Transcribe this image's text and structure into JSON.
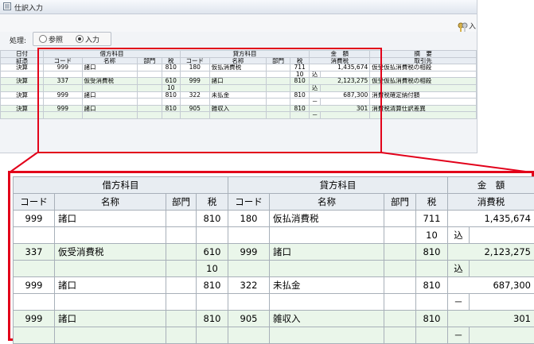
{
  "window": {
    "title": "仕訳入力",
    "toolbar_label": "入"
  },
  "mode": {
    "label": "処理:",
    "options": [
      "参照",
      "入力"
    ],
    "selected": 1
  },
  "small_table": {
    "header_row1": [
      "日付",
      "借方科目",
      "貸方科目",
      "金　額",
      "摘　要"
    ],
    "header_row2": [
      "証憑",
      "コード",
      "名称",
      "部門",
      "税",
      "コード",
      "名称",
      "部門",
      "税",
      "消費税",
      "取引先"
    ],
    "entries": [
      {
        "type": "決算",
        "dr_code": "999",
        "dr_name": "諸口",
        "dr_dept": "",
        "dr_tax": "810",
        "cr_code": "180",
        "cr_name": "仮払消費税",
        "cr_dept": "",
        "cr_tax": "711",
        "amount": "1,435,674",
        "memo": "仮受仮払消費税の相殺",
        "sub": {
          "dr_tax": "",
          "cr_tax": "10",
          "amt_mark": "込"
        }
      },
      {
        "type": "決算",
        "dr_code": "337",
        "dr_name": "仮受消費税",
        "dr_dept": "",
        "dr_tax": "610",
        "cr_code": "999",
        "cr_name": "諸口",
        "cr_dept": "",
        "cr_tax": "810",
        "amount": "2,123,275",
        "memo": "仮受仮払消費税の相殺",
        "sub": {
          "dr_tax": "10",
          "cr_tax": "",
          "amt_mark": "込"
        }
      },
      {
        "type": "決算",
        "dr_code": "999",
        "dr_name": "諸口",
        "dr_dept": "",
        "dr_tax": "810",
        "cr_code": "322",
        "cr_name": "未払金",
        "cr_dept": "",
        "cr_tax": "810",
        "amount": "687,300",
        "memo": "消費税確定納付額",
        "sub": {
          "dr_tax": "",
          "cr_tax": "",
          "amt_mark": "－"
        }
      },
      {
        "type": "決算",
        "dr_code": "999",
        "dr_name": "諸口",
        "dr_dept": "",
        "dr_tax": "810",
        "cr_code": "905",
        "cr_name": "雑収入",
        "cr_dept": "",
        "cr_tax": "810",
        "amount": "301",
        "memo": "消費税清算仕訳差異",
        "sub": {
          "dr_tax": "",
          "cr_tax": "",
          "amt_mark": "－"
        }
      }
    ]
  },
  "large_table": {
    "header_row1": [
      "借方科目",
      "貸方科目",
      "金　額"
    ],
    "header_row2": [
      "コード",
      "名称",
      "部門",
      "税",
      "コード",
      "名称",
      "部門",
      "税",
      "消費税"
    ]
  },
  "colors": {
    "highlight": "#e2001a",
    "row_green": "#eaf6ea",
    "header_bg": "#e8edf2"
  }
}
